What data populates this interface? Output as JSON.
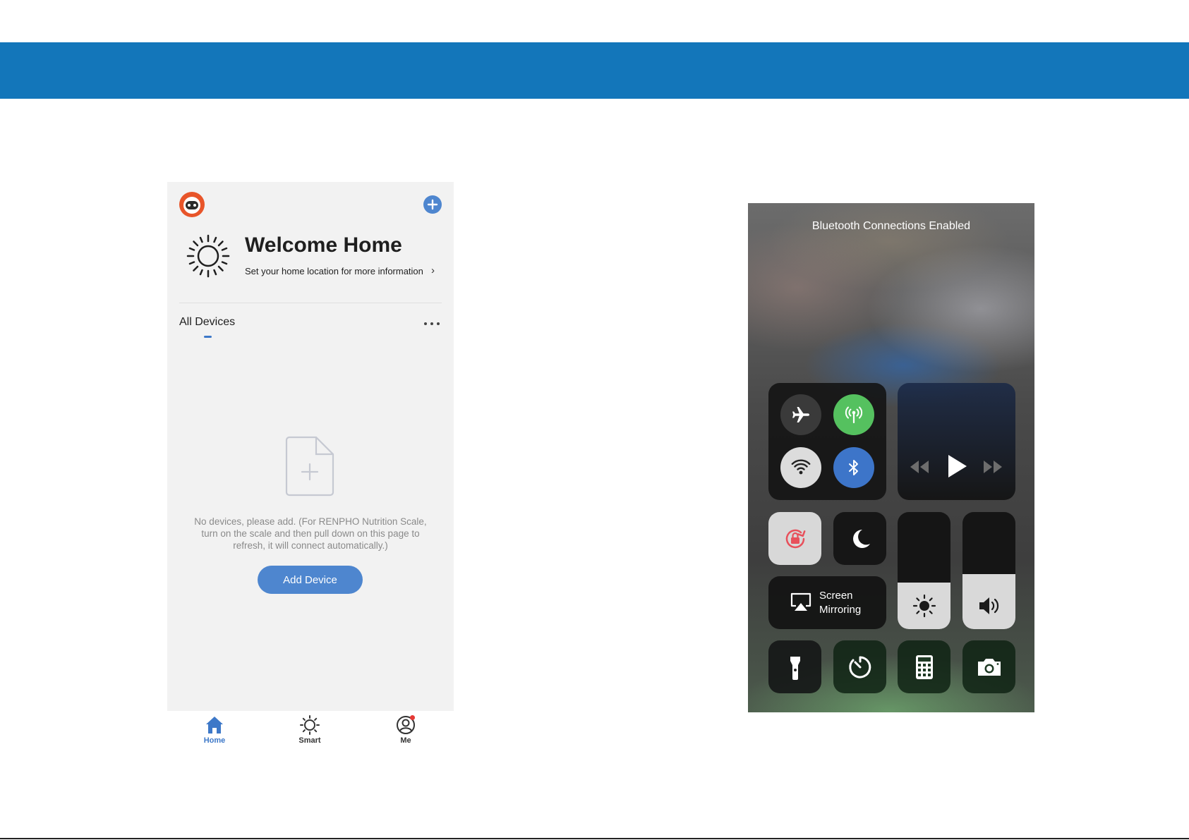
{
  "app": {
    "welcome_title": "Welcome Home",
    "welcome_subtitle": "Set your home location for more information",
    "tab_all_devices": "All Devices",
    "empty_message": "No devices, please add. (For RENPHO Nutrition Scale, turn on the scale and then pull down on this page to refresh, it will connect automatically.)",
    "add_device_label": "Add Device",
    "nav": [
      {
        "label": "Home",
        "icon": "home-icon"
      },
      {
        "label": "Smart",
        "icon": "sun-icon"
      },
      {
        "label": "Me",
        "icon": "user-icon"
      }
    ],
    "colors": {
      "banner": "#1376ba",
      "accent": "#4e86cf",
      "notification": "#e53935"
    }
  },
  "control_center": {
    "status_text": "Bluetooth Connections Enabled",
    "screen_mirroring_line1": "Screen",
    "screen_mirroring_line2": "Mirroring",
    "toggles": {
      "airplane_mode": "off",
      "cellular": "on",
      "wifi": "on",
      "bluetooth": "on",
      "rotation_lock": "on",
      "do_not_disturb": "off"
    },
    "brightness_level": 0.4,
    "volume_level": 0.47,
    "colors": {
      "cellular": "#55c15f",
      "bluetooth": "#3d75c9",
      "rotation_lock": "#e8505b"
    }
  }
}
